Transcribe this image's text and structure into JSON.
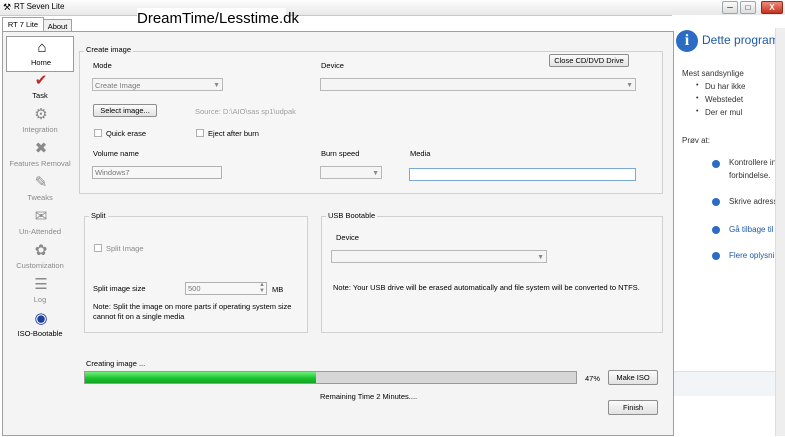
{
  "window": {
    "title": "RT Seven Lite",
    "min": "─",
    "max": "□",
    "close": "X"
  },
  "watermark": "DreamTime/Lesstime.dk",
  "tabs": [
    {
      "label": "RT 7 Lite"
    },
    {
      "label": "About"
    }
  ],
  "sidebar": {
    "items": [
      {
        "label": "Home",
        "icon": "home-icon",
        "glyph": "⌂"
      },
      {
        "label": "Task",
        "icon": "task-icon",
        "glyph": "✔"
      },
      {
        "label": "Integration",
        "icon": "integration-icon",
        "glyph": "⚙"
      },
      {
        "label": "Features Removal",
        "icon": "features-removal-icon",
        "glyph": "✖"
      },
      {
        "label": "Tweaks",
        "icon": "tweaks-icon",
        "glyph": "✎"
      },
      {
        "label": "Un-Attended",
        "icon": "unattended-icon",
        "glyph": "✉"
      },
      {
        "label": "Customization",
        "icon": "customization-icon",
        "glyph": "✿"
      },
      {
        "label": "Log",
        "icon": "log-icon",
        "glyph": "☰"
      },
      {
        "label": "ISO-Bootable",
        "icon": "iso-bootable-icon",
        "glyph": "◉"
      }
    ]
  },
  "create_image": {
    "title": "Create image",
    "mode_label": "Mode",
    "mode_value": "Create Image",
    "device_label": "Device",
    "close_drive_button": "Close CD/DVD Drive",
    "select_image_button": "Select image...",
    "source_text": "Source: D:\\AIO\\sas sp1\\udpak",
    "quick_erase_label": "Quick erase",
    "eject_label": "Eject after burn",
    "volume_name_label": "Volume name",
    "volume_name_value": "Windows7",
    "burn_speed_label": "Burn speed",
    "media_label": "Media",
    "media_value": ""
  },
  "split": {
    "title": "Split",
    "split_image_label": "Split Image",
    "split_size_label": "Split image size",
    "split_size_value": "500",
    "unit": "MB",
    "note": "Note: Split the image on more parts if operating system size cannot fit on a single media"
  },
  "usb": {
    "title": "USB Bootable",
    "device_label": "Device",
    "note": "Note: Your USB drive will be erased automatically and file system will be converted to NTFS."
  },
  "progress": {
    "status": "Creating image ...",
    "percent": 47,
    "percent_text": "47%",
    "remaining": "Remaining Time 2 Minutes....",
    "make_iso_button": "Make ISO",
    "finish_button": "Finish"
  },
  "ie_panel": {
    "title": "Dette program",
    "subtitle": "Mest sandsynlige",
    "bullets": [
      "Du har ikke",
      "Webstedet",
      "Der er mul"
    ],
    "try_label": "Prøv at:",
    "actions": [
      {
        "line1": "Kontrollere in",
        "line2": "forbindelse."
      },
      {
        "line1": "Skrive adress",
        "line2": ""
      },
      {
        "line1": "Gå tilbage til",
        "line2": ""
      },
      {
        "line1": "Flere oplysni",
        "line2": ""
      }
    ],
    "accent_color": "#2b6cc4"
  }
}
